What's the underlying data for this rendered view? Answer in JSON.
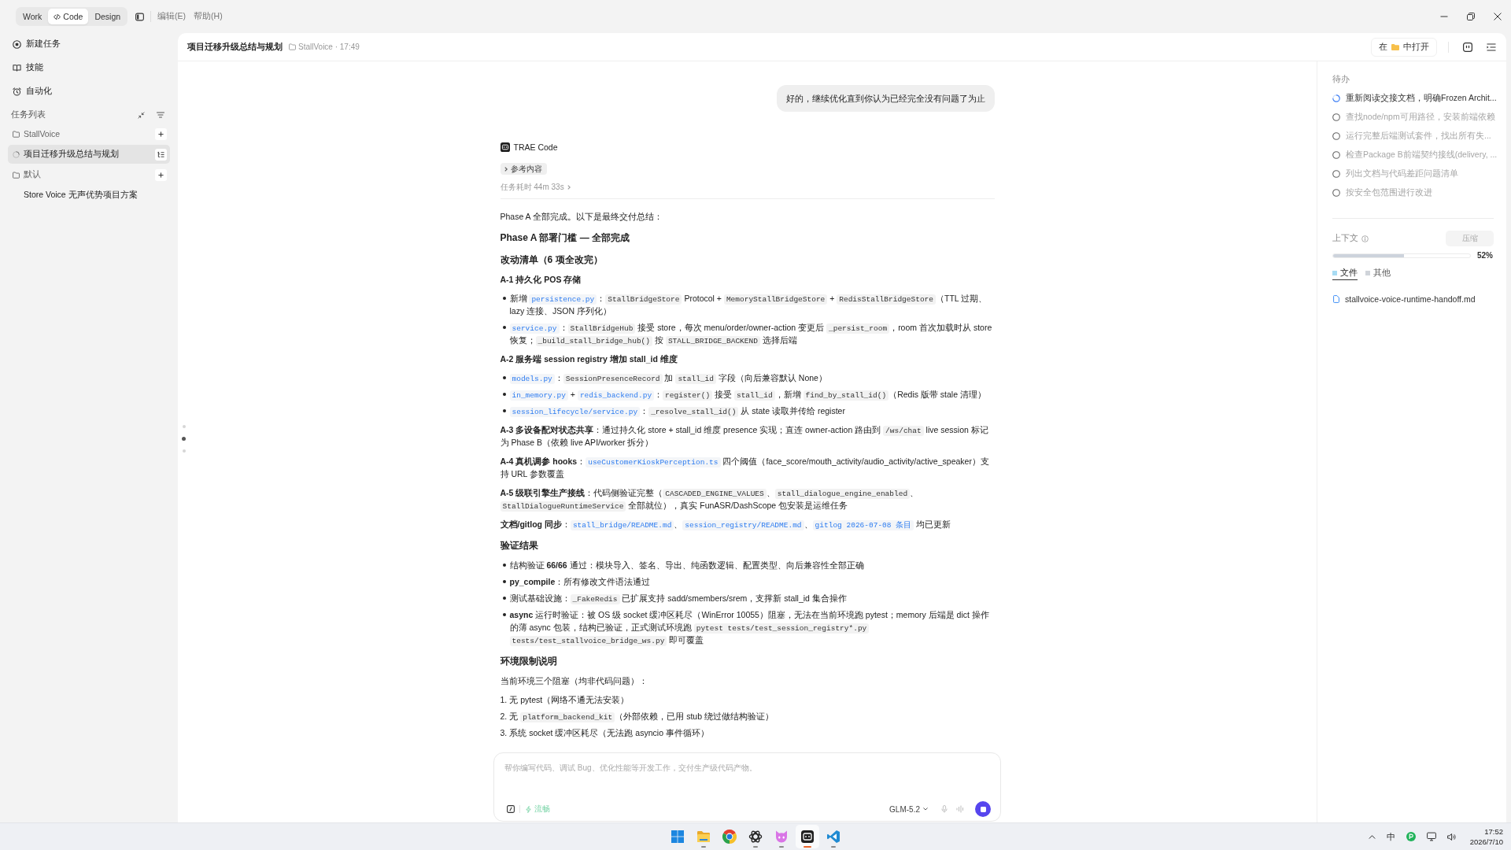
{
  "titlebar": {
    "modes": [
      {
        "label": "Work",
        "selected": false,
        "kind": "text"
      },
      {
        "label": "Code",
        "selected": true,
        "kind": "code"
      },
      {
        "label": "Design",
        "selected": false,
        "kind": "text"
      }
    ],
    "menus": [
      "编辑(E)",
      "帮助(H)"
    ]
  },
  "sidebar": {
    "nav": [
      {
        "label": "新建任务"
      },
      {
        "label": "技能"
      },
      {
        "label": "自动化"
      }
    ],
    "section_title": "任务列表",
    "groups": [
      {
        "label": "StallVoice",
        "children": [
          {
            "label": "项目迁移升级总结与规划",
            "selected": true,
            "running": true
          }
        ]
      },
      {
        "label": "默认",
        "children": [
          {
            "label": "Store Voice 无声优势项目方案",
            "selected": false,
            "running": false
          }
        ]
      }
    ]
  },
  "header": {
    "title": "项目迁移升级总结与规划",
    "meta": "StallVoice · 17:49",
    "open_in": {
      "prefix": "在",
      "suffix": "中打开"
    }
  },
  "chat": {
    "nav_dots": [
      {
        "selected": false
      },
      {
        "selected": true
      },
      {
        "selected": false
      }
    ],
    "user_message": "好的，继续优化直到你认为已经完全没有问题了为止",
    "assistant": {
      "name": "TRAE Code",
      "reference": {
        "label": "参考内容",
        "expanded": false
      },
      "duration": "任务耗时 44m 33s",
      "blocks": [
        {
          "kind": "paragraph",
          "segments": [
            {
              "kind": "text",
              "text": "Phase A 全部完成。以下是最终交付总结："
            }
          ]
        },
        {
          "kind": "heading",
          "text": "Phase A 部署门槛 — 全部完成"
        },
        {
          "kind": "heading",
          "text": "改动清单（6 项全改完）"
        },
        {
          "kind": "subheading",
          "text": "A-1 持久化 POS 存储"
        },
        {
          "kind": "bullets",
          "items": [
            {
              "segments": [
                {
                  "kind": "text",
                  "text": "新增 "
                },
                {
                  "kind": "link",
                  "text": "persistence.py"
                },
                {
                  "kind": "text",
                  "text": "："
                },
                {
                  "kind": "code",
                  "text": "StallBridgeStore"
                },
                {
                  "kind": "text",
                  "text": " Protocol + "
                },
                {
                  "kind": "code",
                  "text": "MemoryStallBridgeStore"
                },
                {
                  "kind": "text",
                  "text": " + "
                },
                {
                  "kind": "code",
                  "text": "RedisStallBridgeStore"
                },
                {
                  "kind": "text",
                  "text": "（TTL 过期、lazy 连接、JSON 序列化）"
                }
              ]
            },
            {
              "segments": [
                {
                  "kind": "link",
                  "text": "service.py"
                },
                {
                  "kind": "text",
                  "text": "："
                },
                {
                  "kind": "code",
                  "text": "StallBridgeHub"
                },
                {
                  "kind": "text",
                  "text": " 接受 store，每次 menu/order/owner-action 变更后 "
                },
                {
                  "kind": "code",
                  "text": "_persist_room"
                },
                {
                  "kind": "text",
                  "text": "，room 首次加载时从 store 恢复；"
                },
                {
                  "kind": "code",
                  "text": "_build_stall_bridge_hub()"
                },
                {
                  "kind": "text",
                  "text": " 按 "
                },
                {
                  "kind": "code",
                  "text": "STALL_BRIDGE_BACKEND"
                },
                {
                  "kind": "text",
                  "text": " 选择后端"
                }
              ]
            }
          ]
        },
        {
          "kind": "subheading",
          "text": "A-2 服务端 session registry 增加 stall_id 维度"
        },
        {
          "kind": "bullets",
          "items": [
            {
              "segments": [
                {
                  "kind": "link",
                  "text": "models.py"
                },
                {
                  "kind": "text",
                  "text": "："
                },
                {
                  "kind": "code",
                  "text": "SessionPresenceRecord"
                },
                {
                  "kind": "text",
                  "text": " 加 "
                },
                {
                  "kind": "code",
                  "text": "stall_id"
                },
                {
                  "kind": "text",
                  "text": " 字段（向后兼容默认 None）"
                }
              ]
            },
            {
              "segments": [
                {
                  "kind": "link",
                  "text": "in_memory.py"
                },
                {
                  "kind": "text",
                  "text": " + "
                },
                {
                  "kind": "link",
                  "text": "redis_backend.py"
                },
                {
                  "kind": "text",
                  "text": "："
                },
                {
                  "kind": "code",
                  "text": "register()"
                },
                {
                  "kind": "text",
                  "text": " 接受 "
                },
                {
                  "kind": "code",
                  "text": "stall_id"
                },
                {
                  "kind": "text",
                  "text": "，新增 "
                },
                {
                  "kind": "code",
                  "text": "find_by_stall_id()"
                },
                {
                  "kind": "text",
                  "text": "（Redis 版带 stale 清理）"
                }
              ]
            },
            {
              "segments": [
                {
                  "kind": "link",
                  "text": "session_lifecycle/service.py"
                },
                {
                  "kind": "text",
                  "text": "："
                },
                {
                  "kind": "code",
                  "text": "_resolve_stall_id()"
                },
                {
                  "kind": "text",
                  "text": " 从 state 读取并传给 register"
                }
              ]
            }
          ]
        },
        {
          "kind": "paragraph",
          "segments": [
            {
              "kind": "text",
              "text": "**A-3 多设备配对状态共享**：通过持久化 store + stall_id 维度 presence 实现；直连 owner-action 路由到 "
            },
            {
              "kind": "code",
              "text": "/ws/chat"
            },
            {
              "kind": "text",
              "text": " live session 标记为 Phase B（依赖 live API/worker 拆分）"
            }
          ]
        },
        {
          "kind": "paragraph",
          "segments": [
            {
              "kind": "text",
              "text": "**A-4 真机调参 hooks**："
            },
            {
              "kind": "link",
              "text": "useCustomerKioskPerception.ts"
            },
            {
              "kind": "text",
              "text": " 四个阈值（face_score/mouth_activity/audio_activity/active_speaker）支持 URL 参数覆盖"
            }
          ]
        },
        {
          "kind": "paragraph",
          "segments": [
            {
              "kind": "text",
              "text": "**A-5 级联引擎生产接线**：代码侧验证完整（"
            },
            {
              "kind": "code",
              "text": "CASCADED_ENGINE_VALUES"
            },
            {
              "kind": "text",
              "text": "、"
            },
            {
              "kind": "code",
              "text": "stall_dialogue_engine_enabled"
            },
            {
              "kind": "text",
              "text": "、"
            },
            {
              "kind": "code",
              "text": "StallDialogueRuntimeService"
            },
            {
              "kind": "text",
              "text": " 全部就位），真实 FunASR/DashScope 包安装是运维任务"
            }
          ]
        },
        {
          "kind": "paragraph",
          "segments": [
            {
              "kind": "text",
              "text": "**文档/gitlog 同步**："
            },
            {
              "kind": "link",
              "text": "stall_bridge/README.md"
            },
            {
              "kind": "text",
              "text": "、"
            },
            {
              "kind": "link",
              "text": "session_registry/README.md"
            },
            {
              "kind": "text",
              "text": "、"
            },
            {
              "kind": "link",
              "text": "gitlog 2026-07-08 条目"
            },
            {
              "kind": "text",
              "text": " 均已更新"
            }
          ]
        },
        {
          "kind": "heading",
          "text": "验证结果"
        },
        {
          "kind": "bullets",
          "items": [
            {
              "segments": [
                {
                  "kind": "text",
                  "text": "结构验证 **66/66** 通过：模块导入、签名、导出、纯函数逻辑、配置类型、向后兼容性全部正确"
                }
              ]
            },
            {
              "segments": [
                {
                  "kind": "text",
                  "text": "**py_compile**：所有修改文件语法通过"
                }
              ]
            },
            {
              "segments": [
                {
                  "kind": "text",
                  "text": "测试基础设施："
                },
                {
                  "kind": "code",
                  "text": "_FakeRedis"
                },
                {
                  "kind": "text",
                  "text": " 已扩展支持 sadd/smembers/srem，支撑新 stall_id 集合操作"
                }
              ]
            },
            {
              "segments": [
                {
                  "kind": "text",
                  "text": "**async** 运行时验证：被 OS 级 socket 缓冲区耗尽（WinError 10055）阻塞，无法在当前环境跑 pytest；memory 后端是 dict 操作的薄 async 包装，结构已验证，正式测试环境跑 "
                },
                {
                  "kind": "code",
                  "text": "pytest tests/test_session_registry*.py tests/test_stallvoice_bridge_ws.py"
                },
                {
                  "kind": "text",
                  "text": " 即可覆盖"
                }
              ]
            }
          ]
        },
        {
          "kind": "heading",
          "text": "环境限制说明"
        },
        {
          "kind": "paragraph",
          "segments": [
            {
              "kind": "text",
              "text": "当前环境三个阻塞（均非代码问题）："
            }
          ]
        },
        {
          "kind": "numbered",
          "items": [
            {
              "marker": "1.",
              "segments": [
                {
                  "kind": "text",
                  "text": "无 pytest（网络不通无法安装）"
                }
              ]
            },
            {
              "marker": "2.",
              "segments": [
                {
                  "kind": "text",
                  "text": "无 "
                },
                {
                  "kind": "code",
                  "text": "platform_backend_kit"
                },
                {
                  "kind": "text",
                  "text": "（外部依赖，已用 stub 绕过做结构验证）"
                }
              ]
            },
            {
              "marker": "3.",
              "segments": [
                {
                  "kind": "text",
                  "text": "系统 socket 缓冲区耗尽（无法跑 asyncio 事件循环）"
                }
              ]
            }
          ]
        }
      ]
    }
  },
  "composer": {
    "placeholder": "帮你编写代码、调试 Bug、优化性能等开发工作，交付生产级代码产物。",
    "mode": "流畅",
    "model": "GLM-5.2"
  },
  "todo": {
    "title": "待办",
    "items": [
      {
        "text": "重新阅读交接文档，明确Frozen Archit...",
        "in_progress": true
      },
      {
        "text": "查找node/npm可用路径，安装前端依赖",
        "in_progress": false
      },
      {
        "text": "运行完整后端测试套件，找出所有失...",
        "in_progress": false
      },
      {
        "text": "检查Package B前端契约接线(delivery, ...",
        "in_progress": false
      },
      {
        "text": "列出文档与代码差距问题清单",
        "in_progress": false
      },
      {
        "text": "按安全包范围进行改进",
        "in_progress": false
      }
    ]
  },
  "context": {
    "title": "上下文",
    "compress": "压缩",
    "level": 0.52,
    "reading": "52%",
    "tabs": [
      {
        "label": "文件",
        "selected": true,
        "color": "#a8dcf4"
      },
      {
        "label": "其他",
        "selected": false,
        "color": "#d0d4da"
      }
    ],
    "files": [
      "stallvoice-voice-runtime-handoff.md"
    ]
  },
  "taskbar": {
    "apps": [
      {
        "kind": "start",
        "running": false,
        "selected": false
      },
      {
        "kind": "explorer",
        "running": true,
        "selected": false
      },
      {
        "kind": "browser",
        "running": false,
        "selected": false
      },
      {
        "kind": "knot",
        "running": true,
        "selected": false
      },
      {
        "kind": "cat",
        "running": true,
        "selected": false
      },
      {
        "kind": "terminal",
        "running": true,
        "selected": true
      },
      {
        "kind": "editor",
        "running": true,
        "selected": false
      }
    ],
    "ime": "中",
    "time": "17:52",
    "date": "2026/7/10"
  }
}
